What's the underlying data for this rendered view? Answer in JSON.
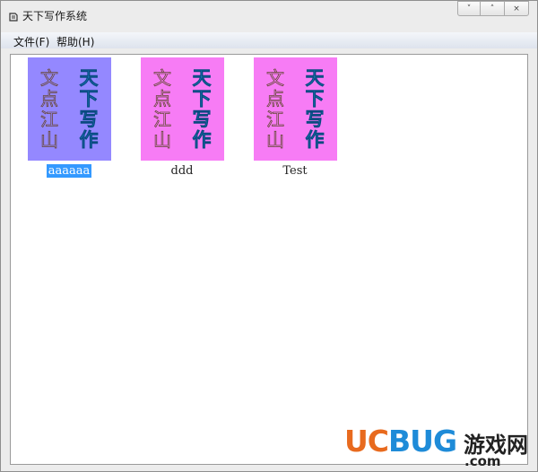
{
  "window": {
    "title": "天下写作系统",
    "controls": {
      "minimize": "˅",
      "maximize": "˄",
      "close": "×"
    }
  },
  "menubar": {
    "items": [
      {
        "label": "文件(F)"
      },
      {
        "label": "帮助(H)"
      }
    ]
  },
  "documents": [
    {
      "name": "aaaaaa",
      "selected": true,
      "cover_color": "#9488ff",
      "cover_lines": {
        "left": "文点江山",
        "right": "天下写作"
      }
    },
    {
      "name": "ddd",
      "selected": false,
      "cover_color": "#f77cf5",
      "cover_lines": {
        "left": "文点江山",
        "right": "天下写作"
      }
    },
    {
      "name": "Test",
      "selected": false,
      "cover_color": "#f77cf5",
      "cover_lines": {
        "left": "文点江山",
        "right": "天下写作"
      }
    }
  ],
  "watermark": {
    "brand": "UCBUG",
    "cn": "游戏网",
    "domain": ".com"
  },
  "colors": {
    "selection": "#3399ff",
    "title_text_blue": "#27a4f0",
    "brand_orange": "#e86a1e",
    "brand_blue": "#1e8bd8"
  }
}
